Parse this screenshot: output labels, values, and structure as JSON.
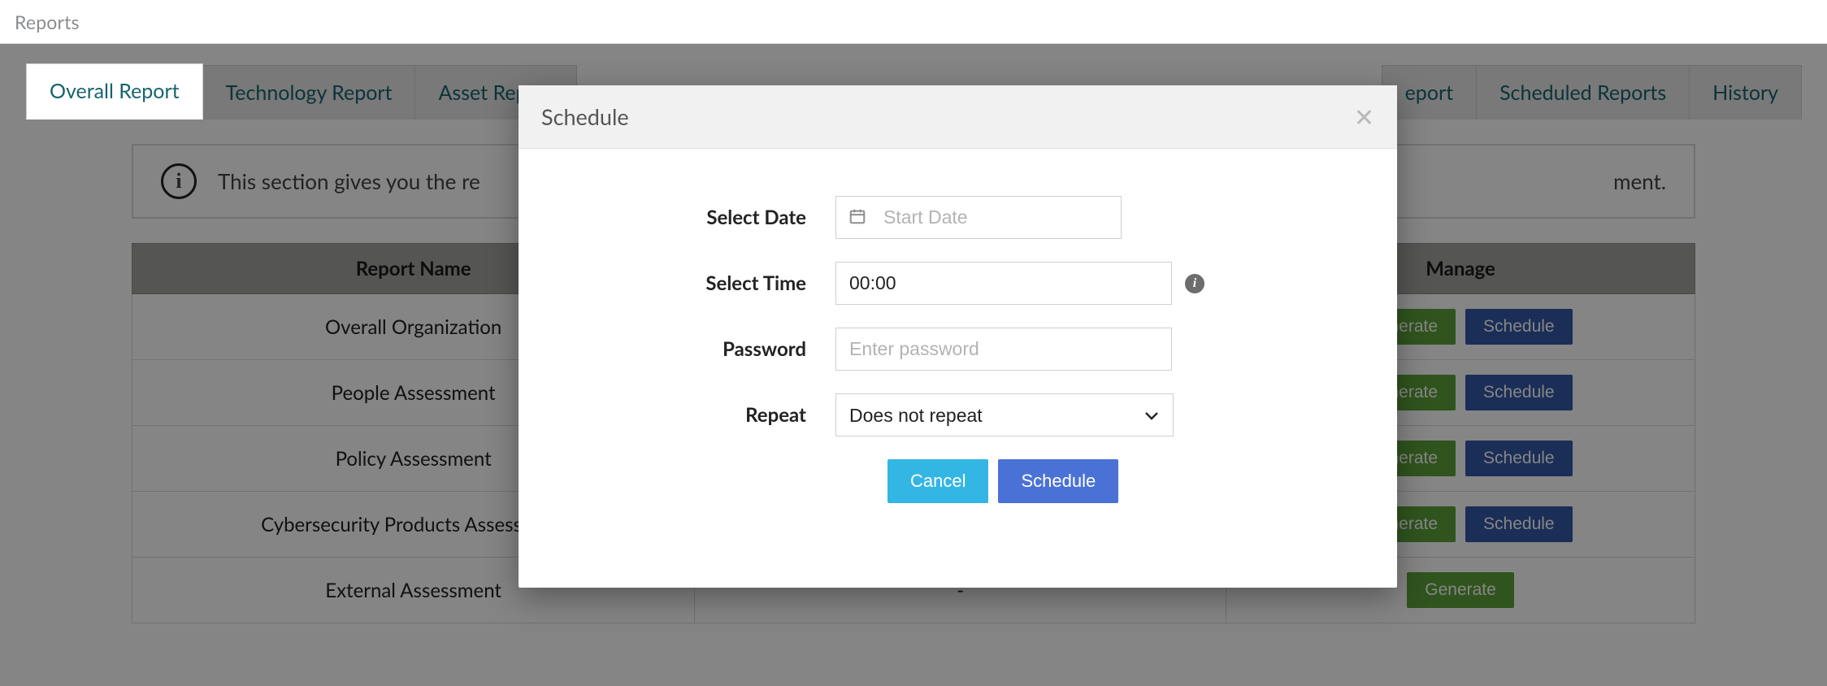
{
  "topbar": {
    "title": "Reports"
  },
  "tabs": [
    {
      "label": "Overall Report",
      "active": true
    },
    {
      "label": "Technology Report",
      "active": false
    },
    {
      "label": "Asset Report",
      "active": false
    },
    {
      "label": "eport",
      "active": false
    },
    {
      "label": "Scheduled Reports",
      "active": false
    },
    {
      "label": "History",
      "active": false
    }
  ],
  "info_text": "This section gives you the re",
  "info_suffix": "ment.",
  "table": {
    "headers": [
      "Report Name",
      "",
      "Manage"
    ],
    "rows": [
      {
        "name": "Overall Organization",
        "col2": "",
        "generate": "Generate",
        "schedule": "Schedule"
      },
      {
        "name": "People Assessment",
        "col2": "",
        "generate": "Generate",
        "schedule": "Schedule"
      },
      {
        "name": "Policy Assessment",
        "col2": "",
        "generate": "Generate",
        "schedule": "Schedule"
      },
      {
        "name": "Cybersecurity Products Assessment",
        "col2": "",
        "generate": "Generate",
        "schedule": "Schedule"
      },
      {
        "name": "External Assessment",
        "col2": "-",
        "generate": "Generate",
        "schedule": null
      }
    ]
  },
  "modal": {
    "title": "Schedule",
    "labels": {
      "date": "Select Date",
      "time": "Select Time",
      "pass": "Password",
      "repeat": "Repeat"
    },
    "date_placeholder": "Start Date",
    "time_value": "00:00",
    "pass_placeholder": "Enter password",
    "repeat_options": [
      "Does not repeat"
    ],
    "repeat_selected": "Does not repeat",
    "buttons": {
      "cancel": "Cancel",
      "schedule": "Schedule"
    }
  }
}
